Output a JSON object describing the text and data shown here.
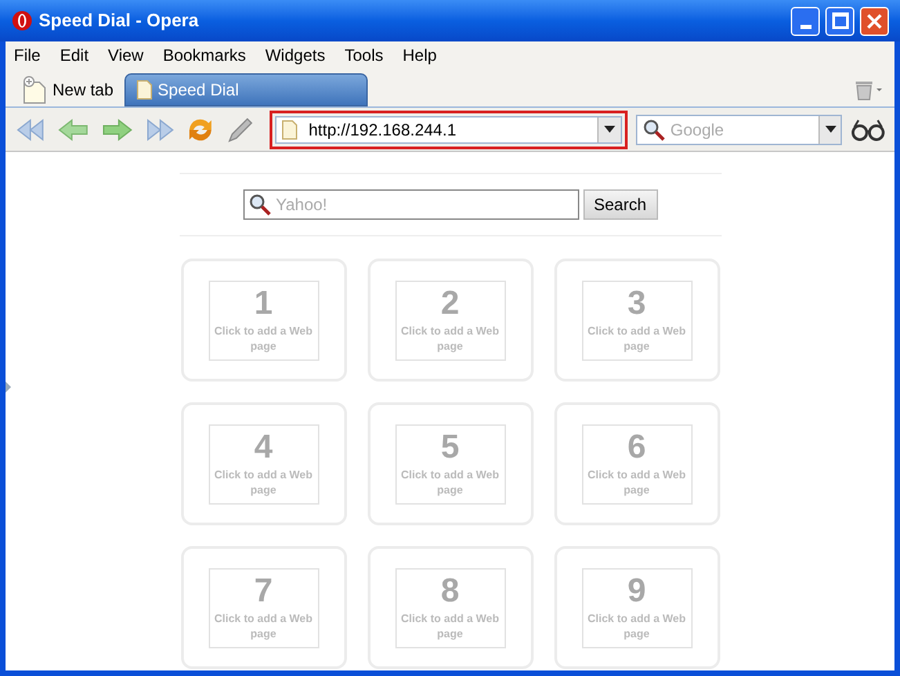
{
  "window": {
    "title": "Speed Dial - Opera"
  },
  "menu": [
    "File",
    "Edit",
    "View",
    "Bookmarks",
    "Widgets",
    "Tools",
    "Help"
  ],
  "new_tab": {
    "label": "New tab"
  },
  "tabs": [
    {
      "label": "Speed Dial",
      "selected": true
    }
  ],
  "address": {
    "value": "http://192.168.244.1"
  },
  "web_search": {
    "placeholder": "Google"
  },
  "page_search": {
    "placeholder": "Yahoo!",
    "button": "Search"
  },
  "speed_dial": [
    {
      "number": "1",
      "hint": "Click to add a Web page"
    },
    {
      "number": "2",
      "hint": "Click to add a Web page"
    },
    {
      "number": "3",
      "hint": "Click to add a Web page"
    },
    {
      "number": "4",
      "hint": "Click to add a Web page"
    },
    {
      "number": "5",
      "hint": "Click to add a Web page"
    },
    {
      "number": "6",
      "hint": "Click to add a Web page"
    },
    {
      "number": "7",
      "hint": "Click to add a Web page"
    },
    {
      "number": "8",
      "hint": "Click to add a Web page"
    },
    {
      "number": "9",
      "hint": "Click to add a Web page"
    }
  ]
}
